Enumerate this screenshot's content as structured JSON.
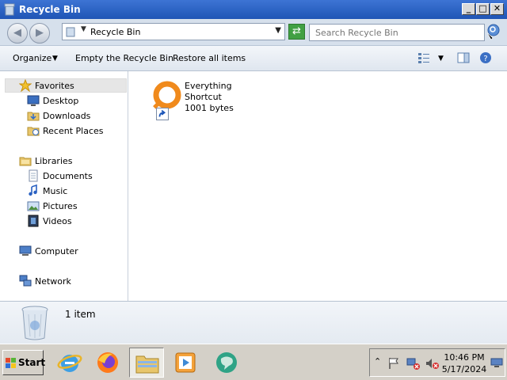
{
  "window": {
    "title": "Recycle Bin"
  },
  "caption_buttons": {
    "minimize": "_",
    "maximize": "□",
    "close": "✕"
  },
  "address_bar": {
    "breadcrumb": "Recycle Bin"
  },
  "search": {
    "placeholder": "Search Recycle Bin"
  },
  "command_bar": {
    "organize": "Organize",
    "empty": "Empty the Recycle Bin",
    "restore": "Restore all items"
  },
  "nav_pane": {
    "favorites": "Favorites",
    "desktop": "Desktop",
    "downloads": "Downloads",
    "recent_places": "Recent Places",
    "libraries": "Libraries",
    "documents": "Documents",
    "music": "Music",
    "pictures": "Pictures",
    "videos": "Videos",
    "computer": "Computer",
    "network": "Network"
  },
  "files": [
    {
      "name": "Everything",
      "type": "Shortcut",
      "size": "1001 bytes",
      "icon": "everything-icon"
    }
  ],
  "details_pane": {
    "item_count": "1 item"
  },
  "taskbar": {
    "start_label": "Start",
    "pinned": [
      "internet-explorer-icon",
      "firefox-icon",
      "windows-explorer-icon",
      "media-player-icon",
      "chat-app-icon"
    ]
  },
  "clock": {
    "time": "10:46 PM",
    "date": "5/17/2024"
  },
  "colors": {
    "title_bar": "#1f55b5",
    "nav_bar": "#d6e0ec",
    "accent_orange": "#f08a1c"
  }
}
